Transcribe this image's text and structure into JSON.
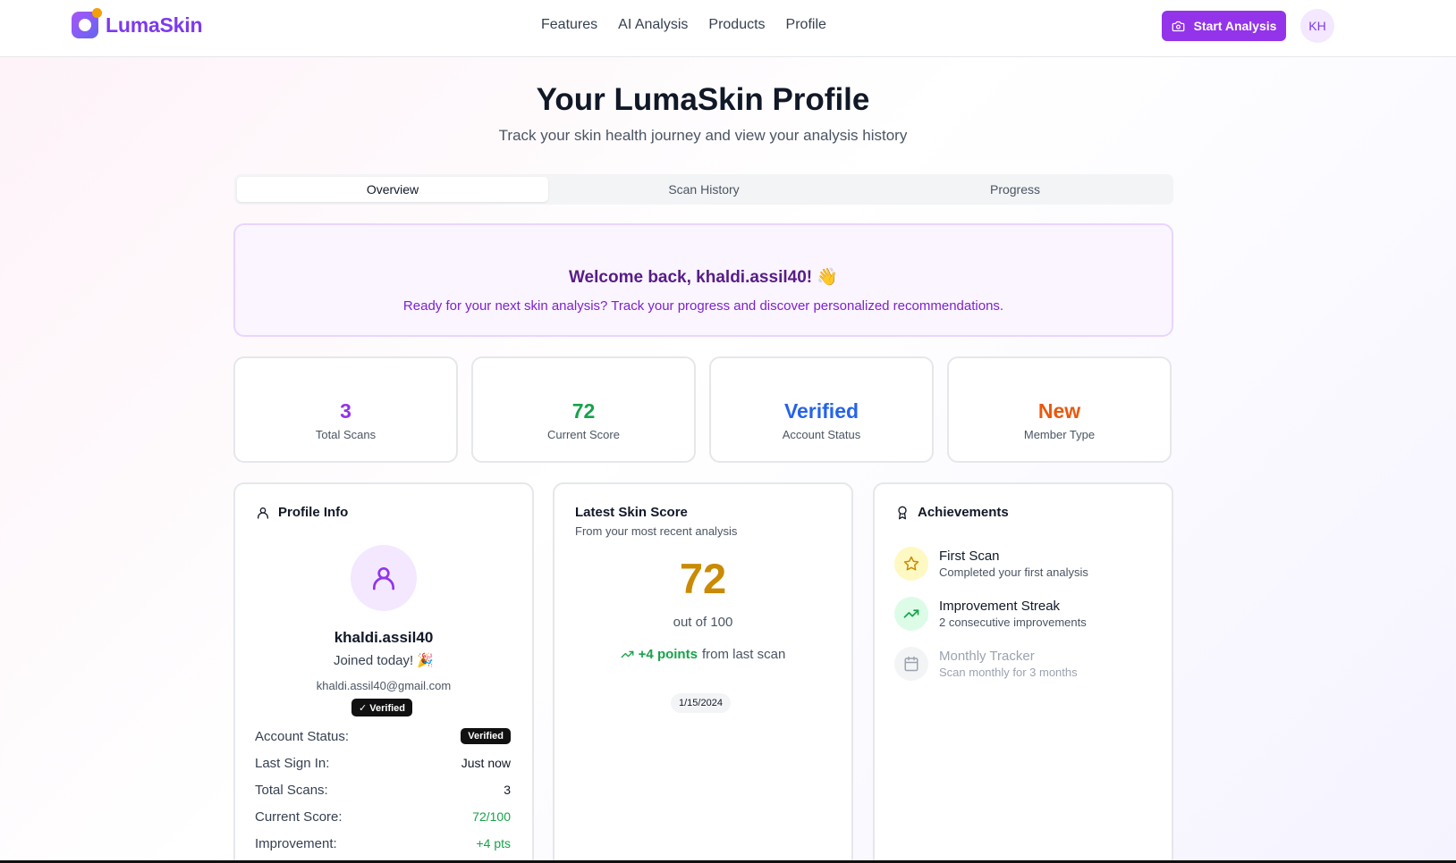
{
  "header": {
    "brand": "LumaSkin",
    "nav": [
      "Features",
      "AI Analysis",
      "Products",
      "Profile"
    ],
    "start_label": "Start Analysis",
    "user_initials": "KH",
    "accent": "#9333ea"
  },
  "page": {
    "title": "Your LumaSkin Profile",
    "subtitle": "Track your skin health journey and view your analysis history"
  },
  "tabs": [
    {
      "label": "Overview",
      "active": true
    },
    {
      "label": "Scan History",
      "active": false
    },
    {
      "label": "Progress",
      "active": false
    }
  ],
  "welcome": {
    "title": "Welcome back, khaldi.assil40! 👋",
    "message": "Ready for your next skin analysis? Track your progress and discover personalized recommendations."
  },
  "stats": [
    {
      "value": "3",
      "label": "Total Scans",
      "color": "#9333ea"
    },
    {
      "value": "72",
      "label": "Current Score",
      "color": "#16a34a"
    },
    {
      "value": "Verified",
      "label": "Account Status",
      "color": "#2563eb"
    },
    {
      "value": "New",
      "label": "Member Type",
      "color": "#ea580c"
    }
  ],
  "profile": {
    "heading": "Profile Info",
    "username": "khaldi.assil40",
    "joined": "Joined today! 🎉",
    "email": "khaldi.assil40@gmail.com",
    "badge": "✓ Verified",
    "rows": [
      {
        "label": "Account Status:",
        "value": "Verified"
      },
      {
        "label": "Last Sign In:",
        "value": "Just now"
      },
      {
        "label": "Total Scans:",
        "value": "3"
      },
      {
        "label": "Current Score:",
        "value": "72/100"
      },
      {
        "label": "Improvement:",
        "value": "+4 pts"
      }
    ]
  },
  "score": {
    "heading": "Latest Skin Score",
    "subheading": "From your most recent analysis",
    "value": "72",
    "out_of": "out of 100",
    "change": "+4 points",
    "change_suffix": "from last scan",
    "date": "1/15/2024"
  },
  "achievements": {
    "heading": "Achievements",
    "items": [
      {
        "title": "First Scan",
        "desc": "Completed your first analysis",
        "icon": "star-icon"
      },
      {
        "title": "Improvement Streak",
        "desc": "2 consecutive improvements",
        "icon": "trending-up-icon"
      },
      {
        "title": "Monthly Tracker",
        "desc": "Scan monthly for 3 months",
        "icon": "calendar-icon"
      }
    ]
  }
}
